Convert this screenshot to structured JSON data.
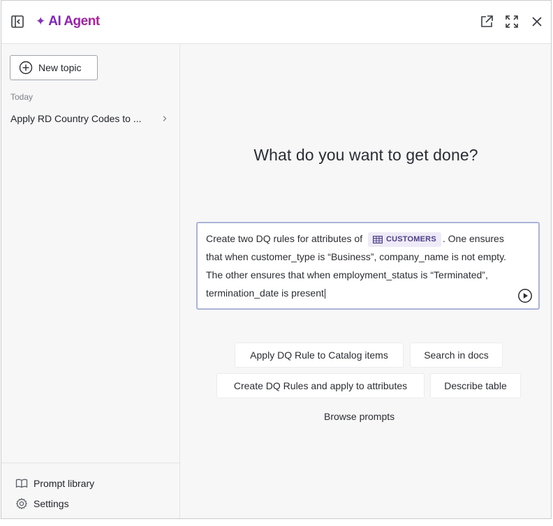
{
  "header": {
    "brand": "AI Agent",
    "brand_spark": "✦",
    "icons": [
      "sidebar-collapse-icon",
      "open-external-icon",
      "expand-icon",
      "close-icon"
    ]
  },
  "sidebar": {
    "new_topic_label": "New topic",
    "section_label": "Today",
    "topics": [
      {
        "label": "Apply RD Country Codes to ..."
      }
    ],
    "bottom": {
      "prompt_library": "Prompt library",
      "settings": "Settings"
    }
  },
  "main": {
    "heading": "What do you want to get done?",
    "prompt": {
      "before_chip": "Create two DQ rules for attributes of ",
      "chip_label": "CUSTOMERS",
      "after_chip": ". One ensures that when customer_type is “Business”, company_name is not empty. The other ensures that when employment_status is “Terminated”, termination_date is present"
    },
    "suggestions": [
      "Apply DQ Rule to Catalog items",
      "Search in docs",
      "Create DQ Rules and apply to attributes",
      "Describe table"
    ],
    "browse_label": "Browse prompts"
  },
  "colors": {
    "brand_start": "#7a22c6",
    "brand_end": "#c01aa0",
    "chip_bg": "#efeaf7",
    "chip_text": "#4f3f8c",
    "input_border": "#a9b3df"
  }
}
